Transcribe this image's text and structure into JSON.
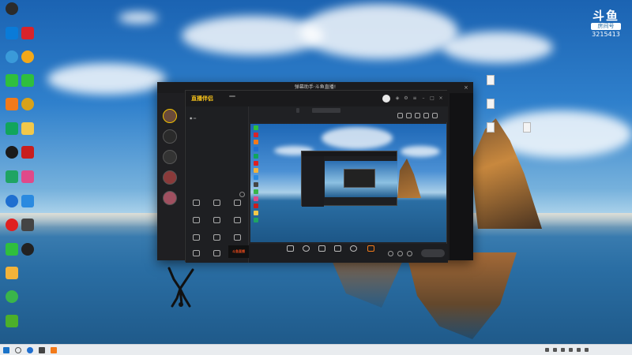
{
  "desktop": {
    "icons_left": [
      {
        "label": "",
        "icon": "g-app-icon",
        "color": "#2b2b2b"
      },
      {
        "label": "",
        "icon": "shield-app-icon",
        "color": "#0a7bd8"
      },
      {
        "label": "",
        "icon": "panda-app-icon",
        "color": "#3a9ad9"
      },
      {
        "label": "",
        "icon": "wechat-icon",
        "color": "#2fbf3d"
      },
      {
        "label": "",
        "icon": "orange-app-icon",
        "color": "#f27a1a"
      },
      {
        "label": "",
        "icon": "green-app-icon",
        "color": "#11a55c"
      },
      {
        "label": "",
        "icon": "qq-icon",
        "color": "#1b1b1b"
      },
      {
        "label": "",
        "icon": "play-store-icon",
        "color": "#1fa463"
      },
      {
        "label": "",
        "icon": "globe-app-icon",
        "color": "#1f6fd0"
      },
      {
        "label": "",
        "icon": "netease-music-icon",
        "color": "#e02020"
      },
      {
        "label": "",
        "icon": "chat-app-icon",
        "color": "#2fbf3d"
      },
      {
        "label": "",
        "icon": "folder-icon",
        "color": "#f2b33a"
      },
      {
        "label": "",
        "icon": "360-app-icon",
        "color": "#3ab54a"
      },
      {
        "label": "",
        "icon": "green-shield-icon",
        "color": "#4caf2a"
      }
    ],
    "icons_second": [
      {
        "label": "",
        "icon": "red-app-icon",
        "color": "#d8232a"
      },
      {
        "label": "",
        "icon": "owl-app-icon",
        "color": "#f2a81a"
      },
      {
        "label": "",
        "icon": "wechat-icon",
        "color": "#2fbf3d"
      },
      {
        "label": "",
        "icon": "chrome-icon",
        "color": "#d8a21a"
      },
      {
        "label": "",
        "icon": "folder-icon",
        "color": "#f2c84a"
      },
      {
        "label": "",
        "icon": "game-app-icon",
        "color": "#c81e1e"
      },
      {
        "label": "",
        "icon": "arrow-app-icon",
        "color": "#e04a8a"
      },
      {
        "label": "",
        "icon": "bird-app-icon",
        "color": "#2a8ae0"
      },
      {
        "label": "",
        "icon": "phone-app-icon",
        "color": "#444444"
      },
      {
        "label": "",
        "icon": "disc-app-icon",
        "color": "#222222"
      }
    ],
    "files": [
      {
        "label": ""
      },
      {
        "label": ""
      },
      {
        "label": ""
      },
      {
        "label": ""
      }
    ]
  },
  "douyu_badge": {
    "logo": "斗鱼",
    "room_label": "房间号",
    "room_number": "3215413"
  },
  "outer_window": {
    "title": "弹幕助手·斗鱼直播!",
    "side_header": "",
    "close": "×"
  },
  "app": {
    "logo_text": "直播伴侣",
    "version": "",
    "controls": [
      "◈",
      "⚙",
      "≡",
      "–",
      "□",
      "×"
    ],
    "tabs": [
      "",
      "",
      ""
    ],
    "scene_label": "",
    "tools_header": "",
    "tools": [
      {
        "label": "",
        "icon": "screen-icon"
      },
      {
        "label": "",
        "icon": "dm-icon"
      },
      {
        "label": "",
        "icon": "gift-icon"
      },
      {
        "label": "",
        "icon": "share-icon"
      },
      {
        "label": "",
        "icon": "record-icon"
      },
      {
        "label": "",
        "icon": "clip-icon"
      },
      {
        "label": "",
        "icon": "eye-icon"
      },
      {
        "label": "",
        "icon": "music-icon"
      },
      {
        "label": "",
        "icon": "ranking-icon"
      },
      {
        "label": "",
        "icon": "link-icon"
      },
      {
        "label": "",
        "icon": "camera-icon"
      }
    ],
    "brand_tile": "斗鱼直播",
    "footer_note": "",
    "info": {
      "title": "",
      "btn_edit": "",
      "btn_cat": "",
      "sub_pill": "",
      "sub_text": ""
    },
    "bottom_bar": [
      {
        "label": "",
        "icon": "scene-icon"
      },
      {
        "label": "",
        "icon": "beauty-icon"
      },
      {
        "label": "",
        "icon": "chat-icon"
      },
      {
        "label": "",
        "icon": "pk-icon"
      },
      {
        "label": "",
        "icon": "mic-icon"
      },
      {
        "label": "",
        "icon": "speaker-icon"
      }
    ],
    "start_live": ""
  },
  "taskbar": {
    "time": "",
    "date": ""
  }
}
